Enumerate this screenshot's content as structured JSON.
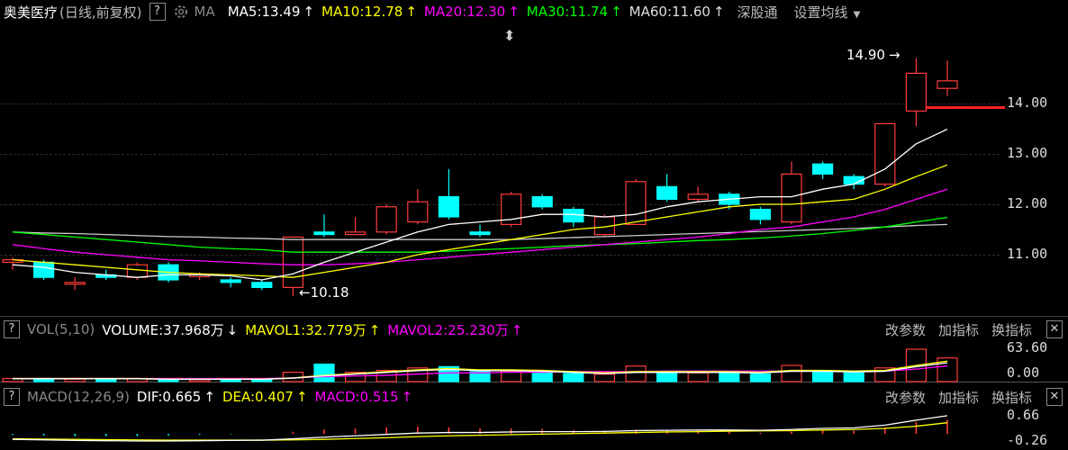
{
  "header": {
    "stock_name": "奥美医疗",
    "mode": "(日线,前复权)",
    "help": "?",
    "ma_label": "MA",
    "ma5": "MA5:13.49",
    "ma10": "MA10:12.78",
    "ma20": "MA20:12.30",
    "ma30": "MA30:11.74",
    "ma60": "MA60:11.60",
    "arrow_up": "↑",
    "exchange": "深股通",
    "settings": "设置均线",
    "drag_handle": "⬍"
  },
  "price_axis": {
    "labels": [
      "14.00",
      "13.00",
      "12.00",
      "11.00"
    ]
  },
  "annotations": {
    "high": "14.90",
    "low": "10.18"
  },
  "volume_header": {
    "help": "?",
    "title": "VOL(5,10)",
    "volume": "VOLUME:37.968万",
    "volume_arrow": "↓",
    "mavol1": "MAVOL1:32.779万",
    "mavol2": "MAVOL2:25.230万",
    "arrow_up": "↑",
    "change_params": "改参数",
    "add_indicator": "加指标",
    "switch_indicator": "换指标",
    "close": "✕"
  },
  "volume_axis": {
    "top": "63.60",
    "bottom": "0.00"
  },
  "macd_header": {
    "help": "?",
    "title": "MACD(12,26,9)",
    "dif": "DIF:0.665",
    "dea": "DEA:0.407",
    "macd": "MACD:0.515",
    "arrow_up": "↑",
    "change_params": "改参数",
    "add_indicator": "加指标",
    "switch_indicator": "换指标",
    "close": "✕"
  },
  "macd_axis": {
    "top": "0.66",
    "bottom": "-0.26"
  },
  "colors": {
    "up": "#ff3c3c",
    "down": "#00ffff",
    "ma5": "#ffffff",
    "ma10": "#ffff00",
    "ma20": "#ff00ff",
    "ma30": "#00ff00",
    "ma60": "#cccccc"
  },
  "chart_data": {
    "type": "candlestick",
    "candles": [
      {
        "o": 10.85,
        "c": 10.9,
        "h": 10.95,
        "l": 10.7
      },
      {
        "o": 10.85,
        "c": 10.55,
        "h": 10.9,
        "l": 10.5
      },
      {
        "o": 10.45,
        "c": 10.45,
        "h": 10.55,
        "l": 10.3
      },
      {
        "o": 10.6,
        "c": 10.55,
        "h": 10.7,
        "l": 10.5
      },
      {
        "o": 10.55,
        "c": 10.8,
        "h": 10.85,
        "l": 10.5
      },
      {
        "o": 10.8,
        "c": 10.5,
        "h": 10.85,
        "l": 10.45
      },
      {
        "o": 10.6,
        "c": 10.6,
        "h": 10.65,
        "l": 10.5
      },
      {
        "o": 10.5,
        "c": 10.45,
        "h": 10.55,
        "l": 10.35
      },
      {
        "o": 10.45,
        "c": 10.35,
        "h": 10.5,
        "l": 10.3
      },
      {
        "o": 10.35,
        "c": 11.35,
        "h": 11.35,
        "l": 10.18
      },
      {
        "o": 11.45,
        "c": 11.4,
        "h": 11.8,
        "l": 11.35
      },
      {
        "o": 11.4,
        "c": 11.45,
        "h": 11.75,
        "l": 11.4
      },
      {
        "o": 11.45,
        "c": 11.95,
        "h": 12.0,
        "l": 11.4
      },
      {
        "o": 11.65,
        "c": 12.05,
        "h": 12.3,
        "l": 11.6
      },
      {
        "o": 12.15,
        "c": 11.75,
        "h": 12.7,
        "l": 11.7
      },
      {
        "o": 11.45,
        "c": 11.4,
        "h": 11.6,
        "l": 11.35
      },
      {
        "o": 11.6,
        "c": 12.2,
        "h": 12.25,
        "l": 11.55
      },
      {
        "o": 12.15,
        "c": 11.95,
        "h": 12.2,
        "l": 11.9
      },
      {
        "o": 11.9,
        "c": 11.65,
        "h": 11.95,
        "l": 11.55
      },
      {
        "o": 11.4,
        "c": 11.75,
        "h": 11.8,
        "l": 11.35
      },
      {
        "o": 11.6,
        "c": 12.45,
        "h": 12.5,
        "l": 11.6
      },
      {
        "o": 12.35,
        "c": 12.1,
        "h": 12.6,
        "l": 12.05
      },
      {
        "o": 12.1,
        "c": 12.2,
        "h": 12.35,
        "l": 12.05
      },
      {
        "o": 12.2,
        "c": 12.0,
        "h": 12.25,
        "l": 11.9
      },
      {
        "o": 11.9,
        "c": 11.7,
        "h": 11.95,
        "l": 11.6
      },
      {
        "o": 11.65,
        "c": 12.6,
        "h": 12.85,
        "l": 11.6
      },
      {
        "o": 12.8,
        "c": 12.6,
        "h": 12.85,
        "l": 12.5
      },
      {
        "o": 12.55,
        "c": 12.4,
        "h": 12.6,
        "l": 12.3
      },
      {
        "o": 12.4,
        "c": 13.6,
        "h": 13.6,
        "l": 12.35
      },
      {
        "o": 13.85,
        "c": 14.6,
        "h": 14.9,
        "l": 13.55
      },
      {
        "o": 14.3,
        "c": 14.45,
        "h": 14.85,
        "l": 14.15
      }
    ],
    "ma5": [
      10.8,
      10.75,
      10.65,
      10.6,
      10.55,
      10.6,
      10.6,
      10.58,
      10.5,
      10.62,
      10.85,
      11.05,
      11.25,
      11.45,
      11.6,
      11.65,
      11.7,
      11.8,
      11.8,
      11.75,
      11.8,
      11.95,
      12.05,
      12.1,
      12.15,
      12.15,
      12.3,
      12.4,
      12.7,
      13.2,
      13.49
    ],
    "ma10": [
      10.9,
      10.85,
      10.8,
      10.75,
      10.7,
      10.65,
      10.62,
      10.6,
      10.58,
      10.55,
      10.65,
      10.75,
      10.85,
      11.0,
      11.1,
      11.2,
      11.3,
      11.4,
      11.5,
      11.55,
      11.65,
      11.75,
      11.85,
      11.95,
      12.0,
      12.0,
      12.05,
      12.1,
      12.3,
      12.55,
      12.78
    ],
    "ma20": [
      11.2,
      11.12,
      11.05,
      11.0,
      10.95,
      10.9,
      10.88,
      10.85,
      10.82,
      10.8,
      10.8,
      10.82,
      10.85,
      10.9,
      10.95,
      11.0,
      11.05,
      11.1,
      11.15,
      11.2,
      11.25,
      11.3,
      11.35,
      11.42,
      11.5,
      11.55,
      11.65,
      11.75,
      11.9,
      12.1,
      12.3
    ],
    "ma30": [
      11.45,
      11.4,
      11.35,
      11.3,
      11.25,
      11.2,
      11.15,
      11.12,
      11.1,
      11.05,
      11.05,
      11.05,
      11.05,
      11.05,
      11.07,
      11.1,
      11.12,
      11.15,
      11.18,
      11.2,
      11.22,
      11.25,
      11.28,
      11.3,
      11.33,
      11.37,
      11.42,
      11.48,
      11.55,
      11.65,
      11.74
    ],
    "ma60": [
      11.45,
      11.43,
      11.42,
      11.4,
      11.38,
      11.36,
      11.35,
      11.33,
      11.32,
      11.3,
      11.3,
      11.3,
      11.3,
      11.3,
      11.3,
      11.3,
      11.3,
      11.32,
      11.34,
      11.36,
      11.38,
      11.4,
      11.42,
      11.44,
      11.46,
      11.48,
      11.5,
      11.52,
      11.55,
      11.58,
      11.6
    ],
    "price_range": [
      10.0,
      15.0
    ],
    "volumes": [
      5,
      5,
      4,
      4,
      5,
      4,
      3,
      4,
      3,
      15,
      28,
      15,
      18,
      22,
      24,
      16,
      17,
      14,
      13,
      12,
      25,
      16,
      14,
      13,
      12,
      26,
      16,
      14,
      22,
      52,
      37.968
    ],
    "mavol1": [
      5,
      5,
      5,
      5,
      5,
      4,
      4,
      4,
      4,
      6,
      10,
      13,
      16,
      19,
      21,
      19,
      19,
      18,
      16,
      14,
      16,
      16,
      16,
      16,
      15,
      18,
      18,
      17,
      18,
      26,
      32.779
    ],
    "mavol2": [
      5,
      5,
      5,
      5,
      5,
      5,
      5,
      5,
      5,
      6,
      8,
      9,
      10,
      12,
      14,
      14,
      15,
      15,
      16,
      16,
      16,
      17,
      17,
      17,
      17,
      17,
      17,
      17,
      17,
      20,
      25.23
    ],
    "volume_range": [
      0,
      63.6
    ],
    "dif": [
      -0.2,
      -0.22,
      -0.24,
      -0.25,
      -0.26,
      -0.26,
      -0.25,
      -0.24,
      -0.23,
      -0.18,
      -0.12,
      -0.07,
      -0.02,
      0.03,
      0.05,
      0.05,
      0.07,
      0.08,
      0.08,
      0.09,
      0.12,
      0.13,
      0.14,
      0.14,
      0.13,
      0.16,
      0.2,
      0.22,
      0.32,
      0.5,
      0.665
    ],
    "dea": [
      -0.18,
      -0.19,
      -0.2,
      -0.21,
      -0.22,
      -0.23,
      -0.23,
      -0.23,
      -0.23,
      -0.22,
      -0.2,
      -0.17,
      -0.14,
      -0.1,
      -0.07,
      -0.05,
      -0.03,
      -0.01,
      0.01,
      0.03,
      0.05,
      0.07,
      0.08,
      0.1,
      0.11,
      0.12,
      0.14,
      0.16,
      0.2,
      0.28,
      0.407
    ],
    "macd": [
      -0.04,
      -0.06,
      -0.08,
      -0.08,
      -0.08,
      -0.06,
      -0.04,
      -0.02,
      0.0,
      0.08,
      0.16,
      0.2,
      0.24,
      0.26,
      0.24,
      0.2,
      0.2,
      0.18,
      0.14,
      0.12,
      0.14,
      0.12,
      0.12,
      0.08,
      0.04,
      0.08,
      0.12,
      0.12,
      0.24,
      0.44,
      0.515
    ],
    "macd_range": [
      -0.26,
      0.66
    ]
  }
}
